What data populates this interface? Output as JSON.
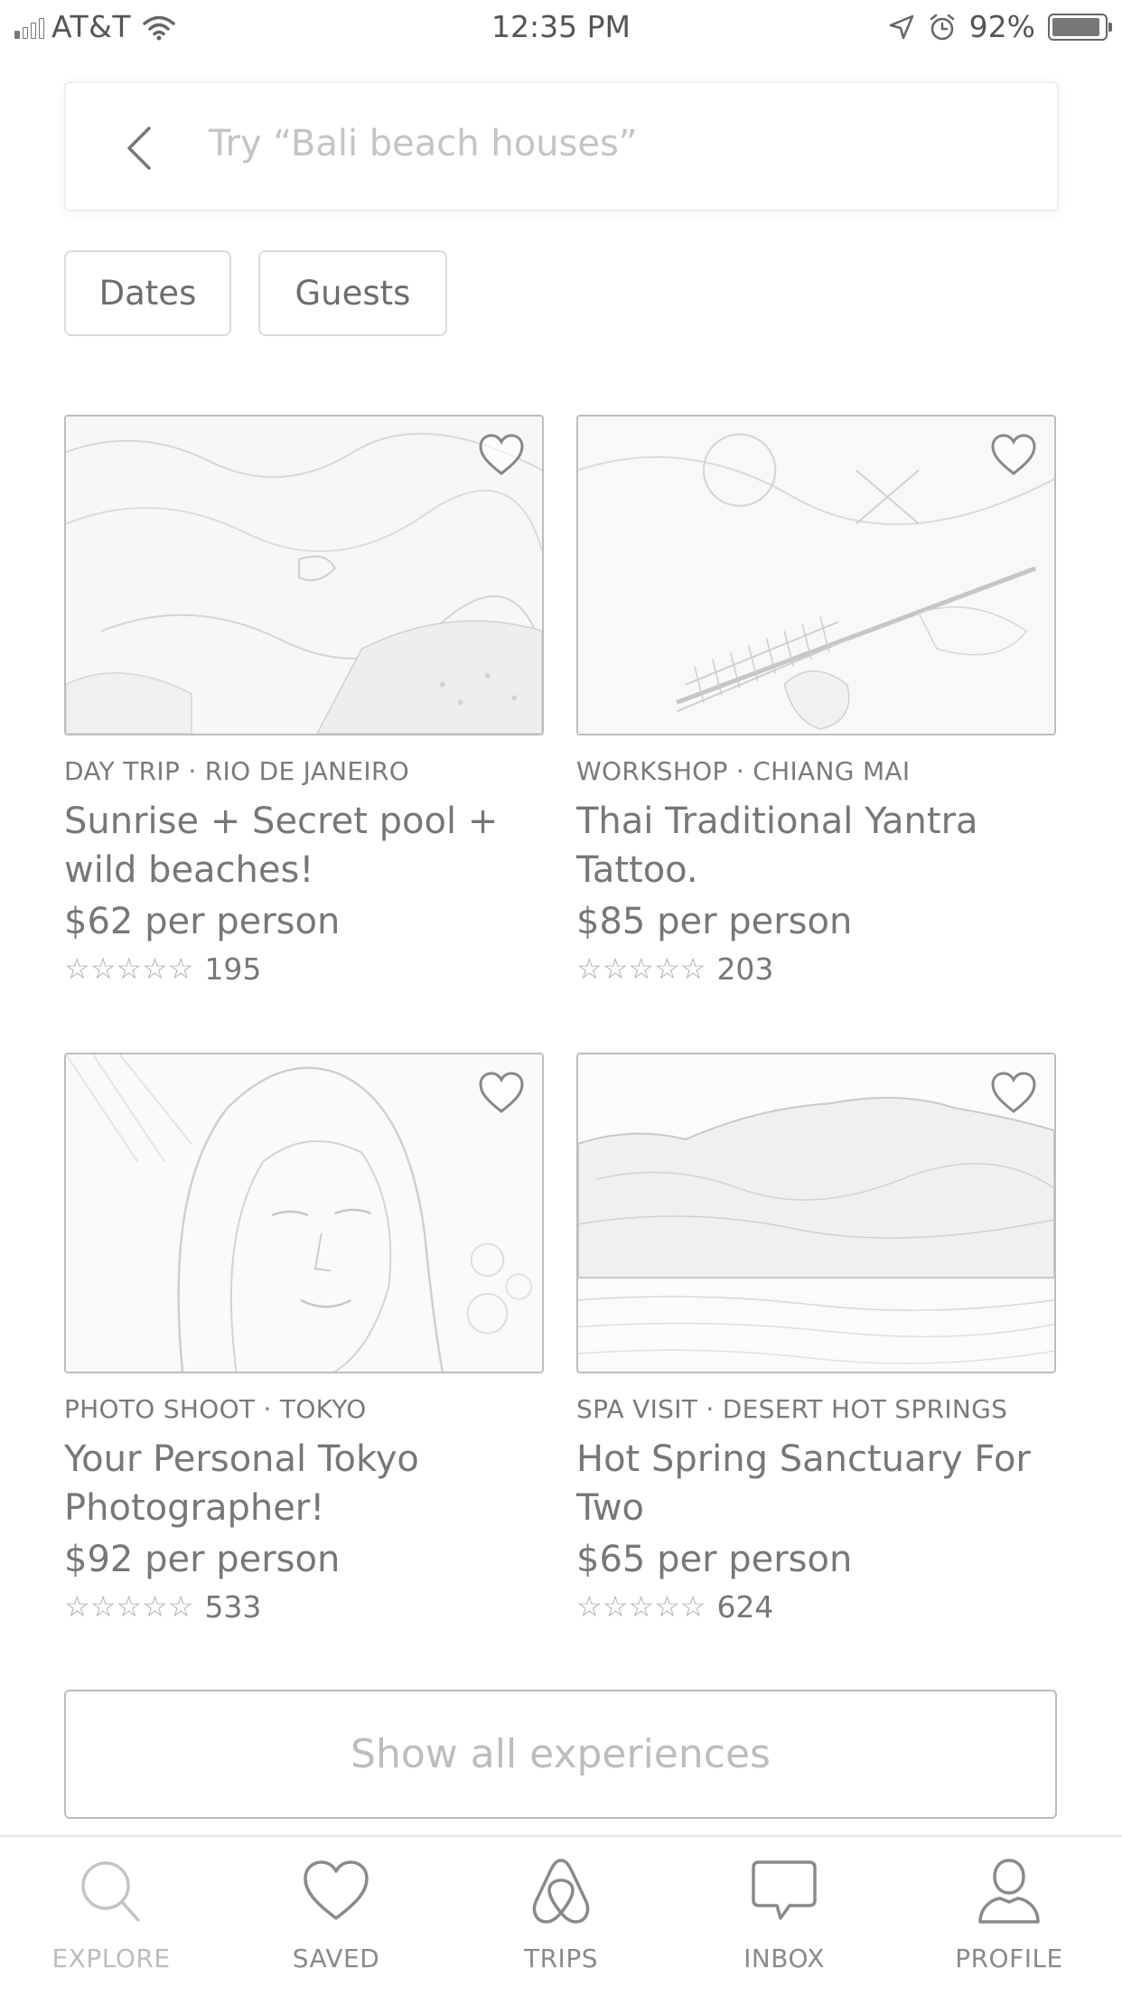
{
  "status_bar": {
    "carrier": "AT&T",
    "time": "12:35 PM",
    "battery_percent": "92%",
    "battery_level": 0.92,
    "icons": [
      "signal-icon",
      "wifi-icon",
      "location-arrow-icon",
      "alarm-icon",
      "battery-icon"
    ]
  },
  "search": {
    "placeholder": "Try “Bali beach houses”",
    "back_icon": "chevron-left-icon"
  },
  "filters": {
    "dates_label": "Dates",
    "guests_label": "Guests"
  },
  "experiences": [
    {
      "category": "DAY TRIP · RIO DE JANEIRO",
      "title": "Sunrise + Secret pool + wild beaches!",
      "price": "$62 per person",
      "stars": "☆☆☆☆☆",
      "rating": 5,
      "reviews": "195",
      "favorite_icon": "heart-outline-icon"
    },
    {
      "category": "WORKSHOP · CHIANG MAI",
      "title": "Thai Traditional Yantra Tattoo.",
      "price": "$85 per person",
      "stars": "☆☆☆☆☆",
      "rating": 5,
      "reviews": "203",
      "favorite_icon": "heart-outline-icon"
    },
    {
      "category": "PHOTO SHOOT · TOKYO",
      "title": "Your Personal Tokyo Photographer!",
      "price": "$92 per person",
      "stars": "☆☆☆☆☆",
      "rating": 5,
      "reviews": "533",
      "favorite_icon": "heart-outline-icon"
    },
    {
      "category": "SPA VISIT · DESERT HOT SPRINGS",
      "title": "Hot Spring Sanctuary For Two",
      "price": "$65 per person",
      "stars": "☆☆☆☆☆",
      "rating": 5,
      "reviews": "624",
      "favorite_icon": "heart-outline-icon"
    }
  ],
  "show_all_label": "Show all experiences",
  "tabs": [
    {
      "label": "EXPLORE",
      "icon": "search-icon",
      "active": true
    },
    {
      "label": "SAVED",
      "icon": "heart-icon",
      "active": false
    },
    {
      "label": "TRIPS",
      "icon": "airbnb-logo-icon",
      "active": false
    },
    {
      "label": "INBOX",
      "icon": "chat-bubble-icon",
      "active": false
    },
    {
      "label": "PROFILE",
      "icon": "person-icon",
      "active": false
    }
  ]
}
